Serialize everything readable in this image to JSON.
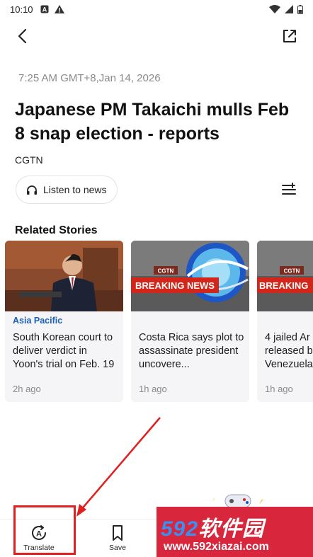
{
  "status_bar": {
    "time": "10:10",
    "left_icons": [
      "A-badge-icon",
      "warning-icon"
    ],
    "right_icons": [
      "wifi-icon",
      "signal-icon",
      "battery-icon"
    ]
  },
  "top_bar": {
    "back_icon": "chevron-left-icon",
    "share_icon": "share-out-icon"
  },
  "article": {
    "timestamp": "7:25 AM GMT+8,Jan 14, 2026",
    "headline": "Japanese PM Takaichi mulls Feb 8 snap election - reports",
    "source": "CGTN",
    "listen_label": "Listen to news",
    "listen_icon": "headphones-icon",
    "font_icon": "text-size-icon"
  },
  "related": {
    "title": "Related Stories",
    "cards": [
      {
        "tag": "Asia Pacific",
        "text": "South Korean court to deliver verdict in Yoon's trial on Feb. 19",
        "time": "2h ago",
        "image": "courtroom-photo"
      },
      {
        "tag": "",
        "text": "Costa Rica says plot to assassinate president uncovere...",
        "time": "1h ago",
        "image": "breaking-news-graphic",
        "banner": "BREAKING NEWS",
        "brand": "CGTN"
      },
      {
        "tag": "",
        "text": "4 jailed Ar released b Venezuela",
        "time": "1h ago",
        "image": "breaking-news-graphic",
        "banner": "BREAKING",
        "brand": "CGTN"
      }
    ]
  },
  "bottom_bar": {
    "translate_label": "Translate",
    "translate_icon": "translate-icon",
    "save_label": "Save",
    "save_icon": "bookmark-icon"
  },
  "watermark": {
    "digits": "592",
    "text": "软件园",
    "url": "www.592xiazai.com"
  },
  "colors": {
    "tag_blue": "#1b5fb6",
    "highlight_red": "#e02020",
    "card_bg": "#f5f5f7",
    "watermark_red": "#d8263c"
  }
}
